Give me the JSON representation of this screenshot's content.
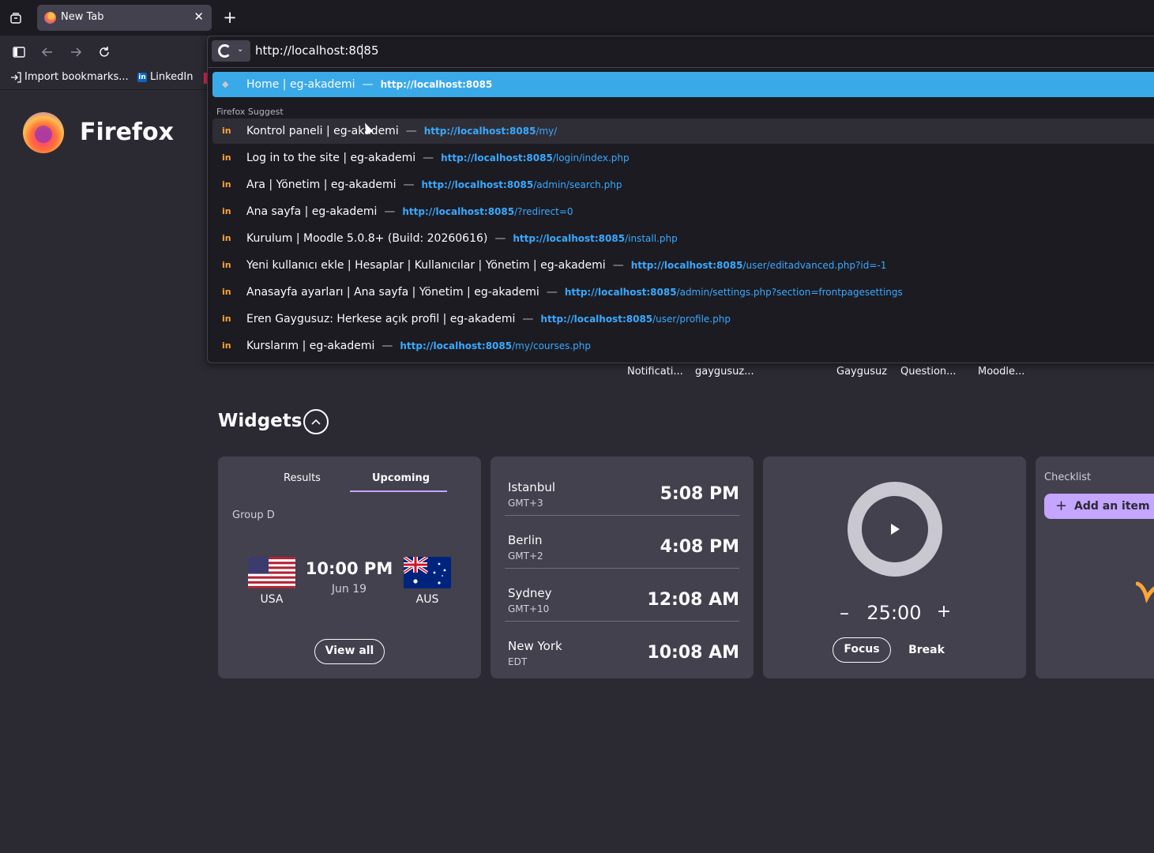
{
  "tabs": {
    "active_title": "New Tab",
    "close_symbol": "✕",
    "new_tab_symbol": "+"
  },
  "icons": {
    "list_all_tabs": "list-all-tabs-icon",
    "sidebar": "sidebar-icon",
    "back": "back-arrow-icon",
    "forward": "forward-arrow-icon",
    "reload": "reload-icon"
  },
  "bookmarks": {
    "import": "Import bookmarks...",
    "linkedin": "LinkedIn",
    "linkedin_icon": "in"
  },
  "urlbar": {
    "value": "http://localhost:8085",
    "search_engine": "google-icon",
    "search_engine_chevron": "⌄"
  },
  "dropdown": {
    "top_result": {
      "title": "Home | eg-akademi",
      "separator": "—",
      "url_host": "http://localhost:8085",
      "url_path": ""
    },
    "section_header": "Firefox Suggest",
    "suggestions": [
      {
        "title": "Kontrol paneli | eg-akademi",
        "separator": "—",
        "url_host": "http://localhost:8085",
        "url_path": "/my/"
      },
      {
        "title": "Log in to the site | eg-akademi",
        "separator": "—",
        "url_host": "http://localhost:8085",
        "url_path": "/login/index.php"
      },
      {
        "title": "Ara | Yönetim | eg-akademi",
        "separator": "—",
        "url_host": "http://localhost:8085",
        "url_path": "/admin/search.php"
      },
      {
        "title": "Ana sayfa | eg-akademi",
        "separator": "—",
        "url_host": "http://localhost:8085",
        "url_path": "/?redirect=0"
      },
      {
        "title": "Kurulum | Moodle 5.0.8+ (Build: 20260616)",
        "separator": "—",
        "url_host": "http://localhost:8085",
        "url_path": "/install.php"
      },
      {
        "title": "Yeni kullanıcı ekle | Hesaplar | Kullanıcılar | Yönetim | eg-akademi",
        "separator": "—",
        "url_host": "http://localhost:8085",
        "url_path": "/user/editadvanced.php?id=-1"
      },
      {
        "title": "Anasayfa ayarları | Ana sayfa | Yönetim | eg-akademi",
        "separator": "—",
        "url_host": "http://localhost:8085",
        "url_path": "/admin/settings.php?section=frontpagesettings"
      },
      {
        "title": "Eren Gaygusuz: Herkese açık profil | eg-akademi",
        "separator": "—",
        "url_host": "http://localhost:8085",
        "url_path": "/user/profile.php"
      },
      {
        "title": "Kurslarım | eg-akademi",
        "separator": "—",
        "url_host": "http://localhost:8085",
        "url_path": "/my/courses.php"
      }
    ],
    "suggestion_icon": "in"
  },
  "newtab": {
    "brand": "Firefox",
    "shortcuts": [
      "Notificati...",
      "gaygusuz...",
      "Gaygusuz",
      "Question...",
      "Moodle..."
    ],
    "widgets_title": "Widgets"
  },
  "sports": {
    "tab_results": "Results",
    "tab_upcoming": "Upcoming",
    "group": "Group D",
    "home_team": "USA",
    "away_team": "AUS",
    "time": "10:00 PM",
    "date": "Jun 19",
    "view_all": "View all"
  },
  "clocks": [
    {
      "city": "Istanbul",
      "tz": "GMT+3",
      "time": "5:08 PM"
    },
    {
      "city": "Berlin",
      "tz": "GMT+2",
      "time": "4:08 PM"
    },
    {
      "city": "Sydney",
      "tz": "GMT+10",
      "time": "12:08 AM"
    },
    {
      "city": "New York",
      "tz": "EDT",
      "time": "10:08 AM"
    }
  ],
  "timer": {
    "value": "25:00",
    "minus": "–",
    "plus": "+",
    "focus": "Focus",
    "break": "Break",
    "play_icon": "play-icon"
  },
  "checklist": {
    "label": "Checklist",
    "add_item": "Add an item",
    "plus": "+"
  },
  "colors": {
    "selected_result": "#3aa9e8",
    "accent_purple": "#c4a5ff",
    "link_blue": "#39a9ff"
  }
}
